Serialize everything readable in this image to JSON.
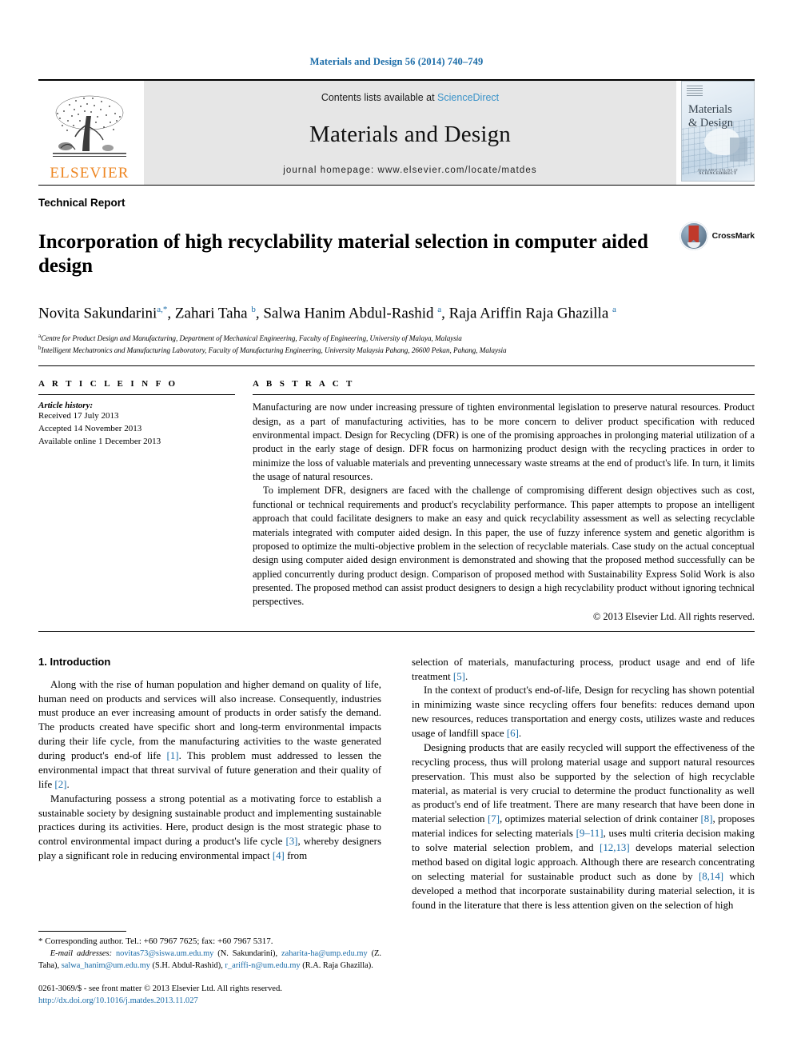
{
  "running_head": "Materials and Design 56 (2014) 740–749",
  "masthead": {
    "publisher": "ELSEVIER",
    "contents_prefix": "Contents lists available at ",
    "contents_link": "ScienceDirect",
    "journal_title": "Materials and Design",
    "homepage": "journal homepage: www.elsevier.com/locate/matdes",
    "cover": {
      "title_line1": "Materials",
      "title_line2": "& Design",
      "footer_top": "AVAILABLE ONLINE AT",
      "footer_bottom": "SCIENCEDIRECT"
    }
  },
  "article": {
    "doctype": "Technical Report",
    "title": "Incorporation of high recyclability material selection in computer aided design",
    "crossmark_label": "CrossMark",
    "authors": [
      {
        "name": "Novita Sakundarini",
        "marks": "a,*"
      },
      {
        "name": "Zahari Taha",
        "marks": "b"
      },
      {
        "name": "Salwa Hanim Abdul-Rashid",
        "marks": "a"
      },
      {
        "name": "Raja Ariffin Raja Ghazilla",
        "marks": "a"
      }
    ],
    "affiliations": [
      {
        "mark": "a",
        "text": "Centre for Product Design and Manufacturing, Department of Mechanical Engineering, Faculty of Engineering, University of Malaya, Malaysia"
      },
      {
        "mark": "b",
        "text": "Intelligent Mechatronics and Manufacturing Laboratory, Faculty of Manufacturing Engineering, University Malaysia Pahang, 26600 Pekan, Pahang, Malaysia"
      }
    ]
  },
  "article_info": {
    "label": "A R T I C L E    I N F O",
    "history_heading": "Article history:",
    "history": [
      "Received 17 July 2013",
      "Accepted 14 November 2013",
      "Available online 1 December 2013"
    ]
  },
  "abstract": {
    "label": "A B S T R A C T",
    "paragraphs": [
      "Manufacturing are now under increasing pressure of tighten environmental legislation to preserve natural resources. Product design, as a part of manufacturing activities, has to be more concern to deliver product specification with reduced environmental impact. Design for Recycling (DFR) is one of the promising approaches in prolonging material utilization of a product in the early stage of design. DFR focus on harmonizing product design with the recycling practices in order to minimize the loss of valuable materials and preventing unnecessary waste streams at the end of product's life. In turn, it limits the usage of natural resources.",
      "To implement DFR, designers are faced with the challenge of compromising different design objectives such as cost, functional or technical requirements and product's recyclability performance. This paper attempts to propose an intelligent approach that could facilitate designers to make an easy and quick recyclability assessment as well as selecting recyclable materials integrated with computer aided design. In this paper, the use of fuzzy inference system and genetic algorithm is proposed to optimize the multi-objective problem in the selection of recyclable materials. Case study on the actual conceptual design using computer aided design environment is demonstrated and showing that the proposed method successfully can be applied concurrently during product design. Comparison of proposed method with Sustainability Express Solid Work is also presented. The proposed method can assist product designers to design a high recyclability product without ignoring technical perspectives."
    ],
    "copyright": "© 2013 Elsevier Ltd. All rights reserved."
  },
  "introduction": {
    "heading": "1. Introduction",
    "left_paragraphs": [
      "Along with the rise of human population and higher demand on quality of life, human need on products and services will also increase. Consequently, industries must produce an ever increasing amount of products in order satisfy the demand. The products created have specific short and long-term environmental impacts during their life cycle, from the manufacturing activities to the waste generated during product's end-of life [1]. This problem must addressed to lessen the environmental impact that threat survival of future generation and their quality of life [2].",
      "Manufacturing possess a strong potential as a motivating force to establish a sustainable society by designing sustainable product and implementing sustainable practices during its activities. Here, product design is the most strategic phase to control environmental impact during a product's life cycle [3], whereby designers play a significant role in reducing environmental impact [4] from"
    ],
    "right_paragraphs": [
      "selection of materials, manufacturing process, product usage and end of life treatment [5].",
      "In the context of product's end-of-life, Design for recycling has shown potential in minimizing waste since recycling offers four benefits: reduces demand upon new resources, reduces transportation and energy costs, utilizes waste and reduces usage of landfill space [6].",
      "Designing products that are easily recycled will support the effectiveness of the recycling process, thus will prolong material usage and support natural resources preservation. This must also be supported by the selection of high recyclable material, as material is very crucial to determine the product functionality as well as product's end of life treatment. There are many research that have been done in material selection [7], optimizes material selection of drink container [8], proposes material indices for selecting materials [9–11], uses multi criteria decision making to solve material selection problem, and [12,13] develops material selection method based on digital logic approach. Although there are research concentrating on selecting material for sustainable product such as done by [8,14] which developed a method that incorporate sustainability during material selection, it is found in the literature that there is less attention given on the selection of high"
    ]
  },
  "footnote": {
    "corresponding": "* Corresponding author. Tel.: +60 7967 7625; fax: +60 7967 5317.",
    "email_label": "E-mail addresses:",
    "emails": [
      {
        "address": "novitas73@siswa.um.edu.my",
        "owner": "(N. Sakundarini)"
      },
      {
        "address": "zaharita-ha@ump.edu.my",
        "owner": "(Z. Taha)"
      },
      {
        "address": "salwa_hanim@um.edu.my",
        "owner": "(S.H. Abdul-Rashid)"
      },
      {
        "address": "r_ariffi-n@um.edu.my",
        "owner": "(R.A. Raja Ghazilla)"
      }
    ],
    "issn_line": "0261-3069/$ - see front matter © 2013 Elsevier Ltd. All rights reserved.",
    "doi": "http://dx.doi.org/10.1016/j.matdes.2013.11.027"
  },
  "colors": {
    "link_blue": "#1b6ca8",
    "sciencedirect_blue": "#3a93c9",
    "elsevier_orange": "#ee8622",
    "band_gray": "#e6e6e6"
  }
}
